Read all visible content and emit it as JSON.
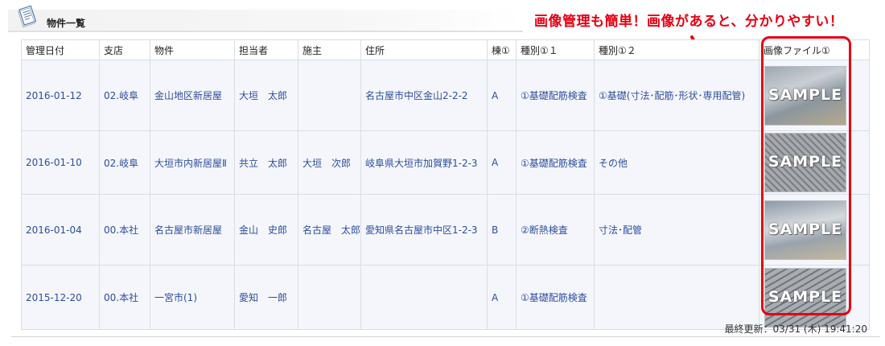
{
  "header": {
    "title": "物件一覧",
    "callout": "画像管理も簡単！画像があると、分かりやすい！"
  },
  "table": {
    "columns": [
      "管理日付",
      "支店",
      "物件",
      "担当者",
      "施主",
      "住所",
      "棟①",
      "種別①１",
      "種別①２",
      "画像ファイル①"
    ],
    "rows": [
      {
        "date": "2016-01-12",
        "branch": "02.岐阜",
        "property": "金山地区新居屋",
        "person": "大垣　太郎",
        "owner": "",
        "address": "名古屋市中区金山2-2-2",
        "building": "A",
        "type1": "①基礎配筋検査",
        "type2": "①基礎(寸法･配筋･形状･専用配管)",
        "image": "SAMPLE"
      },
      {
        "date": "2016-01-10",
        "branch": "02.岐阜",
        "property": "大垣市内新居屋Ⅱ",
        "person": "共立　太郎",
        "owner": "大垣　次郎",
        "address": "岐阜県大垣市加賀野1-2-3",
        "building": "A",
        "type1": "①基礎配筋検査",
        "type2": "その他",
        "image": "SAMPLE"
      },
      {
        "date": "2016-01-04",
        "branch": "00.本社",
        "property": "名古屋市新居屋",
        "person": "金山　史郎",
        "owner": "名古屋　太郎",
        "address": "愛知県名古屋市中区1-2-3",
        "building": "B",
        "type1": "②断熱検査",
        "type2": "寸法･配管",
        "image": "SAMPLE"
      },
      {
        "date": "2015-12-20",
        "branch": "00.本社",
        "property": "一宮市(1)",
        "person": "愛知　一郎",
        "owner": "",
        "address": "",
        "building": "A",
        "type1": "①基礎配筋検査",
        "type2": "",
        "image": "SAMPLE"
      }
    ]
  },
  "footer": {
    "last_updated": "最終更新：03/31 (木) 19:41:20"
  },
  "colors": {
    "accent_red": "#e60012",
    "link_blue": "#2d4d9e",
    "row_bg": "#f4f6fb",
    "border": "#d8dde6"
  },
  "icons": {
    "header": "document-list-icon",
    "arrow": "curly-arrow-icon"
  }
}
